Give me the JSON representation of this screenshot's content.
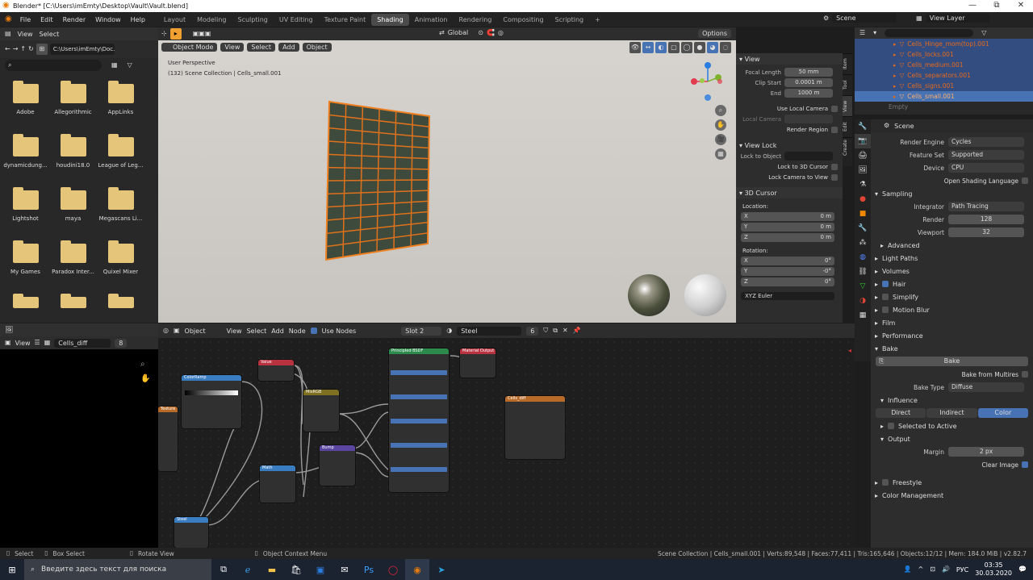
{
  "titlebar": {
    "title": "Blender* [C:\\Users\\imEmty\\Desktop\\Vault\\Vault.blend]",
    "min": "—",
    "max": "⧉",
    "close": "✕"
  },
  "menubar": {
    "menus": [
      "File",
      "Edit",
      "Render",
      "Window",
      "Help"
    ],
    "workspaces": [
      "Layout",
      "Modeling",
      "Sculpting",
      "UV Editing",
      "Texture Paint",
      "Shading",
      "Animation",
      "Rendering",
      "Compositing",
      "Scripting"
    ],
    "active_workspace": "Shading",
    "add": "+",
    "scene": "Scene",
    "view_layer": "View Layer"
  },
  "filebrowser": {
    "menus": [
      "View",
      "Select"
    ],
    "path": "C:\\Users\\imEmty\\Doc...",
    "search_placeholder": "",
    "folders": [
      "Adobe",
      "Allegorithmic",
      "AppLinks",
      "dynamicdung...",
      "houdini18.0",
      "League of Leg...",
      "Lightshot",
      "maya",
      "Megascans Li...",
      "My Games",
      "Paradox Inter...",
      "Quixel Mixer",
      "",
      "",
      ""
    ]
  },
  "viewport": {
    "mode": "Object Mode",
    "menus": [
      "View",
      "Select",
      "Add",
      "Object"
    ],
    "orientation": "Global",
    "options": "Options",
    "info_line1": "User Perspective",
    "info_line2": "(132) Scene Collection | Cells_small.001"
  },
  "npanel": {
    "view_header": "View",
    "focal_label": "Focal Length",
    "focal_value": "50 mm",
    "clip_start_label": "Clip Start",
    "clip_start_value": "0.0001 m",
    "end_label": "End",
    "end_value": "1000 m",
    "use_local_camera": "Use Local Camera",
    "local_camera": "Local Camera",
    "render_region": "Render Region",
    "view_lock_header": "View Lock",
    "lock_to_object": "Lock to Object",
    "lock_to_cursor": "Lock to 3D Cursor",
    "lock_camera": "Lock Camera to View",
    "cursor_header": "3D Cursor",
    "location_label": "Location:",
    "loc_x": "0 m",
    "loc_y": "0 m",
    "loc_z": "0 m",
    "rotation_label": "Rotation:",
    "rot_x": "0°",
    "rot_y": "-0°",
    "rot_z": "0°",
    "euler": "XYZ Euler",
    "tabs": [
      "Item",
      "Tool",
      "View",
      "Edit",
      "Create"
    ]
  },
  "outliner": {
    "items": [
      {
        "name": "Cells_Hinge_mom(top).001",
        "selected": true
      },
      {
        "name": "Cells_locks.001",
        "selected": true
      },
      {
        "name": "Cells_medium.001",
        "selected": true
      },
      {
        "name": "Cells_separators.001",
        "selected": true
      },
      {
        "name": "Cells_signs.001",
        "selected": true
      },
      {
        "name": "Cells_small.001",
        "selected": true
      }
    ],
    "empty": "Empty"
  },
  "properties": {
    "scene": "Scene",
    "render_engine_label": "Render Engine",
    "render_engine": "Cycles",
    "feature_set_label": "Feature Set",
    "feature_set": "Supported",
    "device_label": "Device",
    "device": "CPU",
    "osl": "Open Shading Language",
    "sampling": "Sampling",
    "integrator_label": "Integrator",
    "integrator": "Path Tracing",
    "render_label": "Render",
    "render_val": "128",
    "viewport_label": "Viewport",
    "viewport_val": "32",
    "advanced": "Advanced",
    "light_paths": "Light Paths",
    "volumes": "Volumes",
    "hair": "Hair",
    "simplify": "Simplify",
    "motion_blur": "Motion Blur",
    "film": "Film",
    "performance": "Performance",
    "bake": "Bake",
    "bake_button": "Bake",
    "bake_multires": "Bake from Multires",
    "bake_type_label": "Bake Type",
    "bake_type": "Diffuse",
    "influence": "Influence",
    "direct": "Direct",
    "indirect": "Indirect",
    "color": "Color",
    "selected_to_active": "Selected to Active",
    "output": "Output",
    "margin_label": "Margin",
    "margin": "2 px",
    "clear_image": "Clear Image",
    "freestyle": "Freestyle",
    "color_management": "Color Management"
  },
  "imageeditor": {
    "view": "View",
    "image_name": "Cells_diff",
    "users": "8"
  },
  "nodeeditor": {
    "object": "Object",
    "menus": [
      "View",
      "Select",
      "Add",
      "Node"
    ],
    "use_nodes": "Use Nodes",
    "slot": "Slot 2",
    "material": "Steel",
    "mat_users": "6",
    "nodes": {
      "principled": "Principled BSDF",
      "output": "Material Output",
      "image": "Cells_diff",
      "colorramp": "ColorRamp",
      "value1": "Value",
      "mix": "MixRGB",
      "bump": "Bump",
      "math": "Math",
      "steel": "Steel",
      "frame": "Texture"
    }
  },
  "status": {
    "select": "Select",
    "box_select": "Box Select",
    "rotate": "Rotate View",
    "context": "Object Context Menu",
    "info": "Scene Collection | Cells_small.001 | Verts:89,548 | Faces:77,411 | Tris:165,646 | Objects:12/12 | Mem: 184.0 MiB | v2.82.7"
  },
  "taskbar": {
    "search": "Введите здесь текст для поиска",
    "lang": "РУС",
    "time": "03:35",
    "date": "30.03.2020"
  }
}
